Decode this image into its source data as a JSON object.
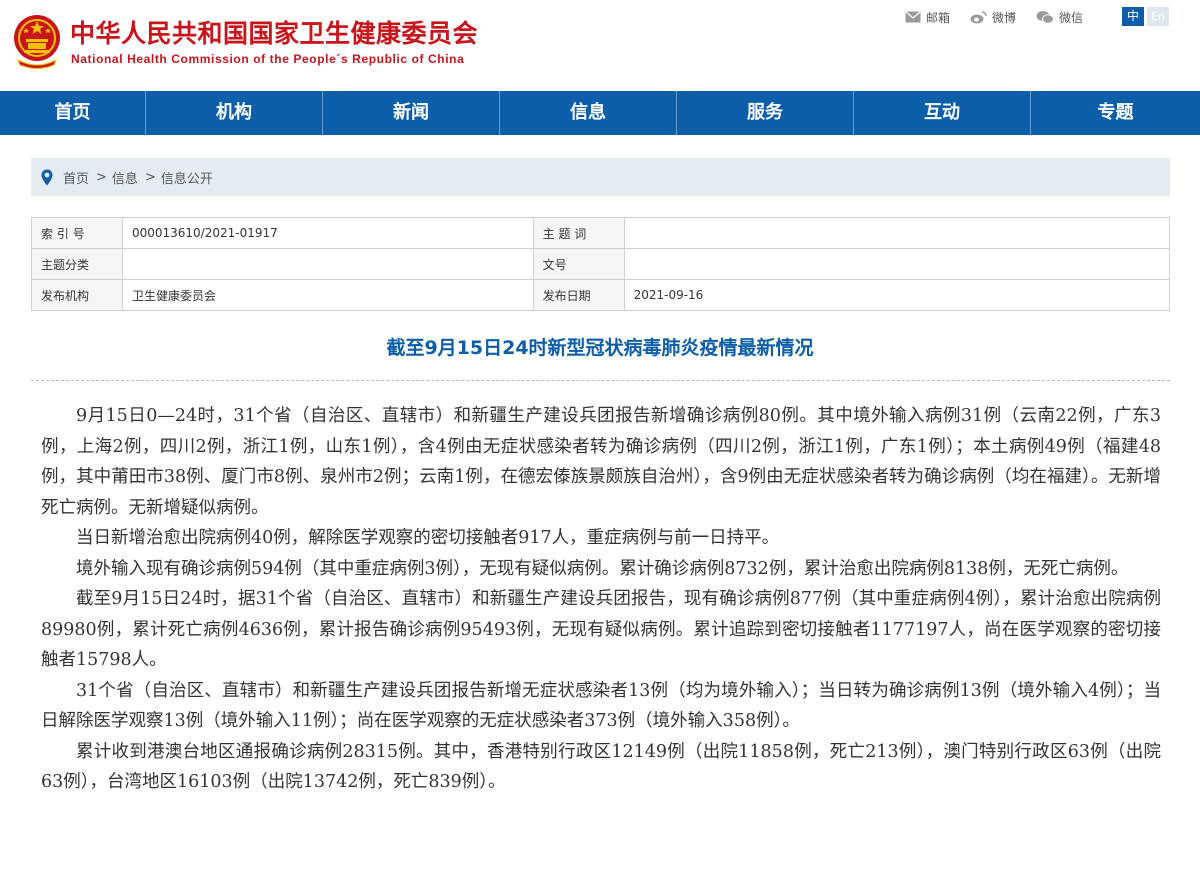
{
  "header": {
    "title_cn": "中华人民共和国国家卫生健康委员会",
    "title_en": "National Health Commission of the People´s Republic of China",
    "links": [
      {
        "label": "邮箱",
        "icon": "mail-icon"
      },
      {
        "label": "微博",
        "icon": "weibo-icon"
      },
      {
        "label": "微信",
        "icon": "wechat-icon"
      }
    ],
    "lang_zh": "中",
    "lang_en": "En"
  },
  "nav": {
    "items": [
      "首页",
      "机构",
      "新闻",
      "信息",
      "服务",
      "互动",
      "专题"
    ]
  },
  "breadcrumb": {
    "items": [
      "首页",
      "信息",
      "信息公开"
    ],
    "separator": ">"
  },
  "meta": {
    "index_label": "索 引 号",
    "index_value": "000013610/2021-01917",
    "keyword_label": "主 题 词",
    "keyword_value": "",
    "category_label": "主题分类",
    "category_value": "",
    "docno_label": "文号",
    "docno_value": "",
    "publisher_label": "发布机构",
    "publisher_value": "卫生健康委员会",
    "date_label": "发布日期",
    "date_value": "2021-09-16"
  },
  "article": {
    "title": "截至9月15日24时新型冠状病毒肺炎疫情最新情况",
    "paragraphs": [
      "9月15日0—24时，31个省（自治区、直辖市）和新疆生产建设兵团报告新增确诊病例80例。其中境外输入病例31例（云南22例，广东3例，上海2例，四川2例，浙江1例，山东1例），含4例由无症状感染者转为确诊病例（四川2例，浙江1例，广东1例）；本土病例49例（福建48例，其中莆田市38例、厦门市8例、泉州市2例；云南1例，在德宏傣族景颇族自治州），含9例由无症状感染者转为确诊病例（均在福建）。无新增死亡病例。无新增疑似病例。",
      "当日新增治愈出院病例40例，解除医学观察的密切接触者917人，重症病例与前一日持平。",
      "境外输入现有确诊病例594例（其中重症病例3例），无现有疑似病例。累计确诊病例8732例，累计治愈出院病例8138例，无死亡病例。",
      "截至9月15日24时，据31个省（自治区、直辖市）和新疆生产建设兵团报告，现有确诊病例877例（其中重症病例4例），累计治愈出院病例89980例，累计死亡病例4636例，累计报告确诊病例95493例，无现有疑似病例。累计追踪到密切接触者1177197人，尚在医学观察的密切接触者15798人。",
      "31个省（自治区、直辖市）和新疆生产建设兵团报告新增无症状感染者13例（均为境外输入）；当日转为确诊病例13例（境外输入4例）；当日解除医学观察13例（境外输入11例）；尚在医学观察的无症状感染者373例（境外输入358例）。",
      "累计收到港澳台地区通报确诊病例28315例。其中，香港特别行政区12149例（出院11858例，死亡213例），澳门特别行政区63例（出院63例），台湾地区16103例（出院13742例，死亡839例）。"
    ]
  },
  "colors": {
    "brand_red": "#c8141b",
    "nav_blue": "#0d5ea8",
    "breadcrumb_bg": "#e6ebf2"
  }
}
